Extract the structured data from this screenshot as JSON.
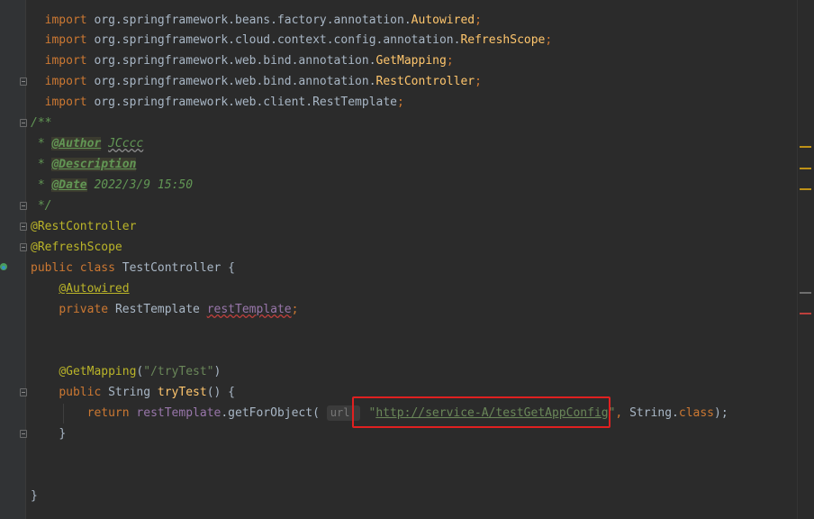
{
  "editor": {
    "lines": [
      {
        "kw": "import",
        "pkg": "org.springframework.beans.factory.annotation.",
        "cls": "Autowired",
        "end": ";"
      },
      {
        "kw": "import",
        "pkg": "org.springframework.cloud.context.config.annotation.",
        "cls": "RefreshScope",
        "end": ";"
      },
      {
        "kw": "import",
        "pkg": "org.springframework.web.bind.annotation.",
        "cls": "GetMapping",
        "end": ";"
      },
      {
        "kw": "import",
        "pkg": "org.springframework.web.bind.annotation.",
        "cls": "RestController",
        "end": ";"
      },
      {
        "kw": "import",
        "pkg": "org.springframework.web.client.",
        "cls": "RestTemplate",
        "end": ";"
      }
    ],
    "javadoc": {
      "open": "/**",
      "author_tag": "@Author",
      "author_value": "JCccc",
      "desc_tag": "@Description",
      "date_tag": "@Date",
      "date_value": "2022/3/9 15:50",
      "close": "*/",
      "star": "*"
    },
    "class_annotations": [
      "@RestController",
      "@RefreshScope"
    ],
    "class_decl": {
      "kw1": "public",
      "kw2": "class",
      "name": "TestController",
      "brace": "{"
    },
    "field": {
      "annotation": "@Autowired",
      "modifier": "private",
      "type": "RestTemplate",
      "name": "restTemplate",
      "end": ";"
    },
    "method": {
      "annotation": "@GetMapping",
      "path_open": "(",
      "path": "\"/tryTest\"",
      "path_close": ")",
      "modifier": "public",
      "return_type": "String",
      "name": "tryTest",
      "params": "() {",
      "return_kw": "return",
      "call_target": "restTemplate",
      "call_method": ".getForObject(",
      "hint_label": "url:",
      "quote": "\"",
      "url": "http://service-A/testGetAppConfig",
      "after_url": ", String.",
      "class_kw": "class",
      "call_end": ");",
      "close_brace": "}"
    },
    "class_close": "}"
  },
  "colors": {
    "background": "#2b2b2b",
    "keyword": "#cc7832",
    "annotation": "#bbb529",
    "string": "#6a8759",
    "highlight_box": "#e02020"
  }
}
